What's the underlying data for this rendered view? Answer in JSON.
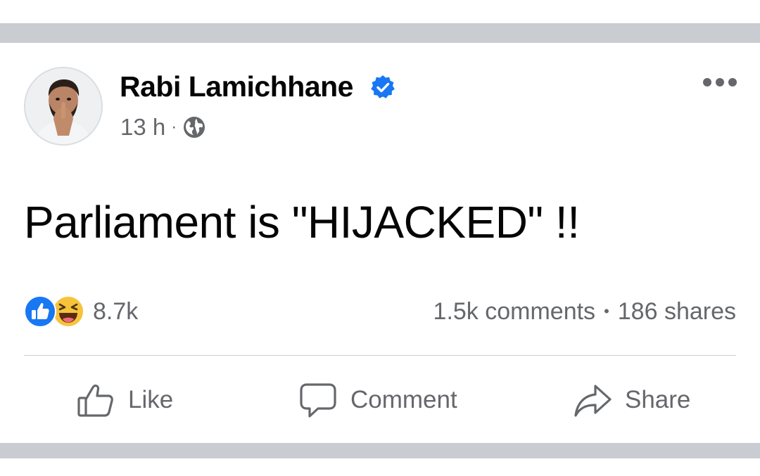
{
  "post": {
    "author": {
      "name": "Rabi Lamichhane",
      "verified": true,
      "avatar_icon": "person-avatar"
    },
    "timestamp": "13 h",
    "meta_separator": "·",
    "audience_icon": "globe-icon",
    "text": "Parliament is \"HIJACKED\" !!",
    "reactions": {
      "types": [
        "like",
        "haha"
      ],
      "count": "8.7k"
    },
    "stats": {
      "comments": "1.5k comments",
      "separator": "•",
      "shares": "186 shares"
    },
    "actions": {
      "like_label": "Like",
      "comment_label": "Comment",
      "share_label": "Share"
    }
  },
  "colors": {
    "divider_band": "#c9ccd1",
    "verified_blue": "#1877f2",
    "secondary_text": "#65676b",
    "primary_text": "#050505",
    "like_blue": "#1877f2",
    "haha_yellow": "#f7c33b"
  }
}
